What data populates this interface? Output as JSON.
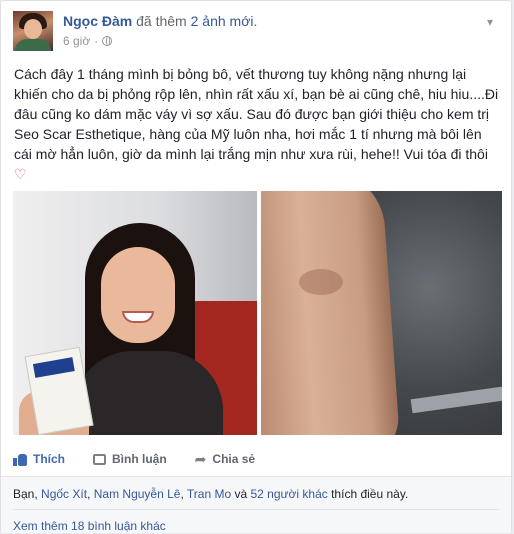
{
  "post": {
    "author": "Ngọc Đàm",
    "action_text": " đã thêm ",
    "action_link": "2 ảnh mới",
    "action_suffix": ".",
    "time": "6 giờ",
    "separator": "·",
    "body": "Cách đây 1 tháng mình bị bỏng bô, vết thương tuy không nặng nhưng lại khiến cho da bị phỏng rộp lên, nhìn rất xấu xí, bạn bè ai cũng chê, hiu hiu....Đi đâu cũng ko dám mặc váy vì sợ xấu. Sau đó được bạn giới thiệu cho kem trị Seo Scar Esthetique, hàng của Mỹ luôn nha, hơi mắc 1 tí nhưng mà bôi lên cái mờ hẳn luôn, giờ da mình lại trắng mịn như xưa rùi, hehe!! Vui tóa đi thôi",
    "heart": "♡"
  },
  "actions": {
    "like": "Thích",
    "comment": "Bình luận",
    "share": "Chia sẻ"
  },
  "likes": {
    "prefix": "Bạn, ",
    "name1": "Ngốc Xít",
    "sep1": ", ",
    "name2": "Nam Nguyễn Lê",
    "sep2": ", ",
    "name3": "Tran Mo",
    "and": " và ",
    "others": "52 người khác",
    "suffix": " thích điều này."
  },
  "comments": {
    "more": "Xem thêm 18 bình luận khác"
  },
  "colors": {
    "link": "#365899",
    "like_active": "#4267b2",
    "muted": "#90949c"
  }
}
